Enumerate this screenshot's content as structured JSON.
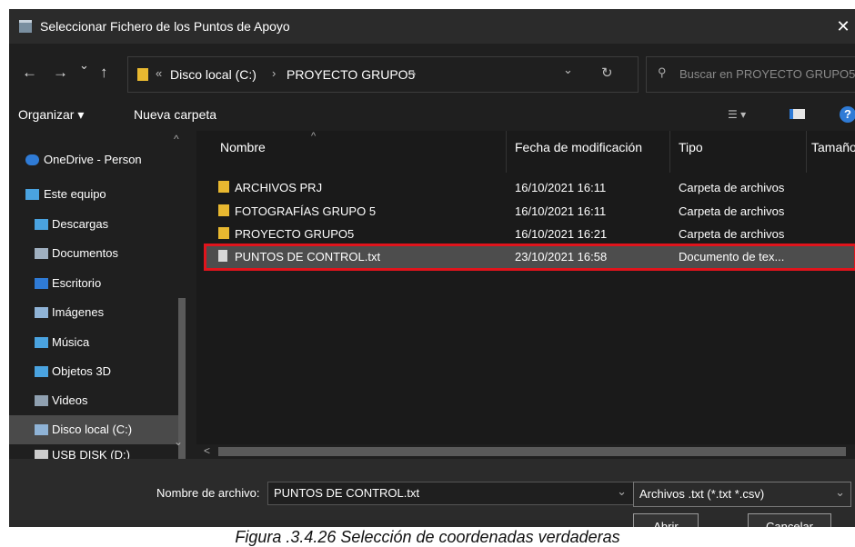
{
  "window": {
    "title": "Seleccionar Fichero de los Puntos de Apoyo",
    "close_glyph": "✕"
  },
  "address": {
    "back_glyph": "←",
    "forward_glyph": "→",
    "recent_glyph": "⌄",
    "up_glyph": "↑",
    "overflow_glyph": "«",
    "crumbs": [
      "Disco local (C:)",
      "PROYECTO GRUPO5"
    ],
    "sep_glyph": "›",
    "dropdown_glyph": "⌄",
    "refresh_glyph": "↻"
  },
  "search": {
    "placeholder": "Buscar en PROYECTO GRUPO5",
    "icon_glyph": "⚲"
  },
  "toolbar": {
    "organize_label": "Organizar ▾",
    "new_folder_label": "Nueva carpeta",
    "view_glyph": "☰ ▾",
    "help_glyph": "?"
  },
  "sidebar": {
    "items": [
      {
        "label": "OneDrive - Person",
        "icon": "cloud-icon",
        "color": "#2f7bd6"
      },
      {
        "label": "Este equipo",
        "icon": "computer-icon",
        "color": "#4aa3e0"
      },
      {
        "label": "Descargas",
        "icon": "download-icon",
        "color": "#4aa3e0"
      },
      {
        "label": "Documentos",
        "icon": "documents-icon",
        "color": "#a0b0c0"
      },
      {
        "label": "Escritorio",
        "icon": "desktop-icon",
        "color": "#2f7bd6"
      },
      {
        "label": "Imágenes",
        "icon": "pictures-icon",
        "color": "#8fb3d6"
      },
      {
        "label": "Música",
        "icon": "music-icon",
        "color": "#4aa3e0"
      },
      {
        "label": "Objetos 3D",
        "icon": "3d-objects-icon",
        "color": "#4aa3e0"
      },
      {
        "label": "Videos",
        "icon": "videos-icon",
        "color": "#8fa0b0"
      },
      {
        "label": "Disco local (C:)",
        "icon": "drive-icon",
        "color": "#8fb3d6"
      },
      {
        "label": "USB DISK (D:)",
        "icon": "usb-drive-icon",
        "color": "#cccccc"
      }
    ],
    "selected_index": 9,
    "scroll_up_glyph": "^",
    "scroll_down_glyph": "⌄"
  },
  "files": {
    "columns": [
      "Nombre",
      "Fecha de modificación",
      "Tipo",
      "Tamaño"
    ],
    "sort_glyph": "^",
    "rows": [
      {
        "name": "ARCHIVOS PRJ",
        "date": "16/10/2021 16:11",
        "type": "Carpeta de archivos",
        "kind": "folder"
      },
      {
        "name": "FOTOGRAFÍAS GRUPO 5",
        "date": "16/10/2021 16:11",
        "type": "Carpeta de archivos",
        "kind": "folder"
      },
      {
        "name": "PROYECTO GRUPO5",
        "date": "16/10/2021 16:21",
        "type": "Carpeta de archivos",
        "kind": "folder"
      },
      {
        "name": "PUNTOS DE CONTROL.txt",
        "date": "23/10/2021 16:58",
        "type": "Documento de tex...",
        "kind": "file"
      }
    ],
    "selected_index": 3,
    "highlight_color": "#e0141c"
  },
  "hscroll": {
    "left_glyph": "<",
    "right_glyph": ">"
  },
  "bottom": {
    "filename_label": "Nombre de archivo:",
    "filename_value": "PUNTOS DE CONTROL.txt",
    "filetype_value": "Archivos .txt (*.txt *.csv)",
    "dropdown_glyph": "⌄",
    "open_label": "Abrir",
    "cancel_label": "Cancelar"
  },
  "caption": "Figura .3.4.26 Selección de coordenadas verdaderas"
}
